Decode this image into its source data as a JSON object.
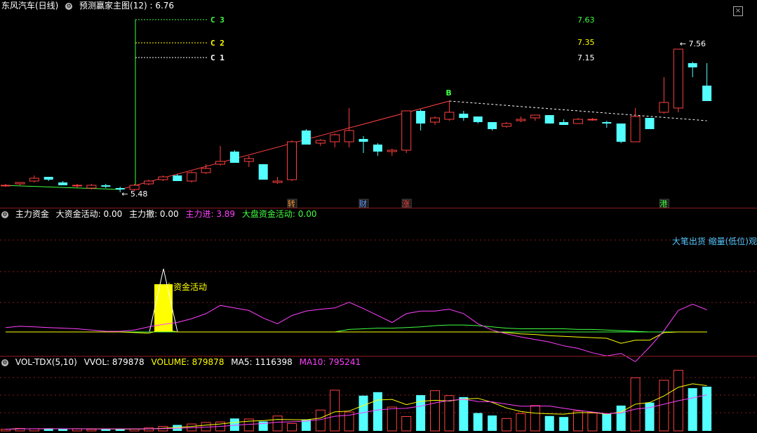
{
  "colors": {
    "up": "#ff4040",
    "down": "#54ffff",
    "bg": "#000000",
    "grid": "#8b1a1a",
    "yellow": "#ffff00",
    "magenta": "#ff40ff",
    "green": "#40ff40",
    "white": "#ffffff",
    "cyan": "#54ffff"
  },
  "main": {
    "title": "东风汽车(日线)",
    "indicator": "预测赢家主图(12) : 6.76",
    "close_icon": "close-icon",
    "labels": {
      "c3": "C 3",
      "c2": "C 2",
      "c1": "C 1",
      "b": "B",
      "v763": "7.63",
      "v735": "7.35",
      "v715": "7.15",
      "v756": "7.56",
      "v548": "5.48"
    },
    "tags": [
      {
        "text": "转",
        "color": "#ff9933"
      },
      {
        "text": "财",
        "color": "#6699ff"
      },
      {
        "text": "涨",
        "color": "#ff4040"
      },
      {
        "text": "港",
        "color": "#40ff40"
      }
    ]
  },
  "fund": {
    "name": "主力资金",
    "f1": "大资金活动: 0.00",
    "f2": "主力撤: 0.00",
    "f3": "主力进: 3.89",
    "f4": "大盘资金活动: 0.00",
    "spike_label": "大资金活动",
    "right_label": "大笔出货 缩量(低位)观"
  },
  "vol": {
    "name": "VOL-TDX(5,10)",
    "f1": "VVOL: 879878",
    "f2": "VOLUME: 879878",
    "f3": "MA5: 1116398",
    "f4": "MA10: 795241"
  },
  "chart_data": {
    "type": "candlestick",
    "ohlc": [
      [
        5.53,
        5.54,
        5.52,
        5.53
      ],
      [
        5.54,
        5.55,
        5.53,
        5.55
      ],
      [
        5.56,
        5.6,
        5.55,
        5.58
      ],
      [
        5.59,
        5.59,
        5.56,
        5.57
      ],
      [
        5.55,
        5.56,
        5.53,
        5.53
      ],
      [
        5.53,
        5.54,
        5.51,
        5.53
      ],
      [
        5.51,
        5.54,
        5.5,
        5.53
      ],
      [
        5.53,
        5.54,
        5.51,
        5.52
      ],
      [
        5.51,
        5.52,
        5.48,
        5.5
      ],
      [
        5.5,
        5.54,
        5.49,
        5.53
      ],
      [
        5.54,
        5.57,
        5.53,
        5.56
      ],
      [
        5.57,
        5.6,
        5.56,
        5.59
      ],
      [
        5.6,
        5.61,
        5.56,
        5.56
      ],
      [
        5.56,
        5.63,
        5.55,
        5.62
      ],
      [
        5.62,
        5.68,
        5.61,
        5.65
      ],
      [
        5.68,
        5.81,
        5.67,
        5.7
      ],
      [
        5.77,
        5.78,
        5.69,
        5.69
      ],
      [
        5.7,
        5.74,
        5.66,
        5.72
      ],
      [
        5.68,
        5.68,
        5.57,
        5.57
      ],
      [
        5.55,
        5.59,
        5.54,
        5.56
      ],
      [
        5.57,
        5.85,
        5.56,
        5.84
      ],
      [
        5.92,
        5.93,
        5.82,
        5.82
      ],
      [
        5.83,
        5.86,
        5.81,
        5.85
      ],
      [
        5.84,
        5.9,
        5.8,
        5.89
      ],
      [
        5.84,
        6.08,
        5.8,
        5.92
      ],
      [
        5.86,
        5.88,
        5.76,
        5.84
      ],
      [
        5.82,
        5.83,
        5.74,
        5.77
      ],
      [
        5.77,
        5.79,
        5.74,
        5.78
      ],
      [
        5.78,
        6.06,
        5.76,
        6.06
      ],
      [
        6.06,
        6.07,
        5.92,
        5.97
      ],
      [
        5.98,
        6.02,
        5.96,
        6.01
      ],
      [
        6.0,
        6.13,
        5.99,
        6.05
      ],
      [
        6.04,
        6.06,
        5.99,
        6.01
      ],
      [
        6.02,
        6.02,
        5.97,
        5.98
      ],
      [
        5.98,
        5.98,
        5.92,
        5.93
      ],
      [
        5.95,
        5.98,
        5.94,
        5.97
      ],
      [
        5.99,
        6.02,
        5.98,
        6.0
      ],
      [
        6.01,
        6.03,
        5.99,
        6.03
      ],
      [
        6.03,
        6.03,
        5.97,
        5.97
      ],
      [
        5.98,
        6.0,
        5.96,
        5.96
      ],
      [
        5.97,
        6.01,
        5.97,
        6.0
      ],
      [
        6.0,
        6.01,
        5.99,
        6.0
      ],
      [
        5.98,
        5.99,
        5.94,
        5.97
      ],
      [
        5.97,
        5.97,
        5.83,
        5.84
      ],
      [
        5.84,
        6.08,
        5.84,
        6.02
      ],
      [
        6.01,
        6.01,
        5.93,
        5.93
      ],
      [
        6.05,
        6.3,
        6.04,
        6.12
      ],
      [
        6.08,
        6.48,
        6.05,
        6.5
      ],
      [
        6.4,
        6.41,
        6.3,
        6.37
      ],
      [
        6.24,
        6.4,
        6.16,
        6.13
      ]
    ],
    "volume": [
      34000,
      50000,
      44000,
      46000,
      38000,
      40000,
      32000,
      36000,
      38000,
      40000,
      60000,
      90000,
      120000,
      140000,
      170000,
      180000,
      250000,
      240000,
      190000,
      300000,
      150000,
      230000,
      420000,
      820000,
      380000,
      710000,
      780000,
      480000,
      290000,
      720000,
      810000,
      710000,
      680000,
      360000,
      310000,
      250000,
      350000,
      510000,
      300000,
      280000,
      400000,
      360000,
      350000,
      510000,
      1070000,
      570000,
      1020000,
      1220000,
      860000,
      890000
    ],
    "fund_lines": {
      "magenta": [
        0.7,
        0.9,
        0.8,
        0.7,
        0.6,
        0.5,
        0.3,
        0.1,
        0.1,
        0.3,
        0.8,
        1.2,
        1.5,
        2.1,
        2.9,
        4.2,
        3.8,
        3.4,
        2.2,
        1.3,
        2.6,
        3.3,
        3.6,
        3.8,
        4.7,
        3.7,
        2.6,
        1.5,
        2.9,
        3.3,
        3.3,
        3.6,
        2.9,
        1.3,
        0.3,
        -0.3,
        -0.8,
        -1.2,
        -1.6,
        -2.2,
        -2.6,
        -3.3,
        -3.8,
        -3.4,
        -4.7,
        -2.4,
        0.2,
        3.4,
        4.4,
        3.5
      ],
      "green": [
        0,
        0,
        0,
        0,
        0,
        0,
        0,
        0,
        0,
        0,
        0,
        0,
        0,
        0,
        0,
        0,
        0,
        0,
        0,
        0,
        0,
        0,
        0,
        0,
        0.4,
        0.5,
        0.6,
        0.6,
        0.7,
        0.8,
        1.0,
        1.1,
        1.1,
        1.0,
        0.8,
        0.6,
        0.5,
        0.5,
        0.5,
        0.5,
        0.4,
        0.4,
        0.3,
        0.2,
        0.1,
        0,
        0,
        0,
        0,
        0
      ],
      "yellow": [
        0,
        0,
        0,
        0,
        0,
        0,
        0,
        0,
        0,
        -0.1,
        -0.2,
        0.4,
        0,
        0,
        0,
        0,
        0,
        0,
        0,
        0,
        0,
        0,
        0,
        0,
        0,
        0,
        0,
        0,
        0,
        0,
        0,
        0,
        0,
        0,
        0,
        -0.1,
        -0.3,
        -0.4,
        -0.6,
        -0.7,
        -0.8,
        -0.9,
        -1.0,
        -1.8,
        -1.3,
        -1.3,
        -0.1,
        0,
        0,
        0
      ]
    },
    "spike_value": 10.0
  }
}
